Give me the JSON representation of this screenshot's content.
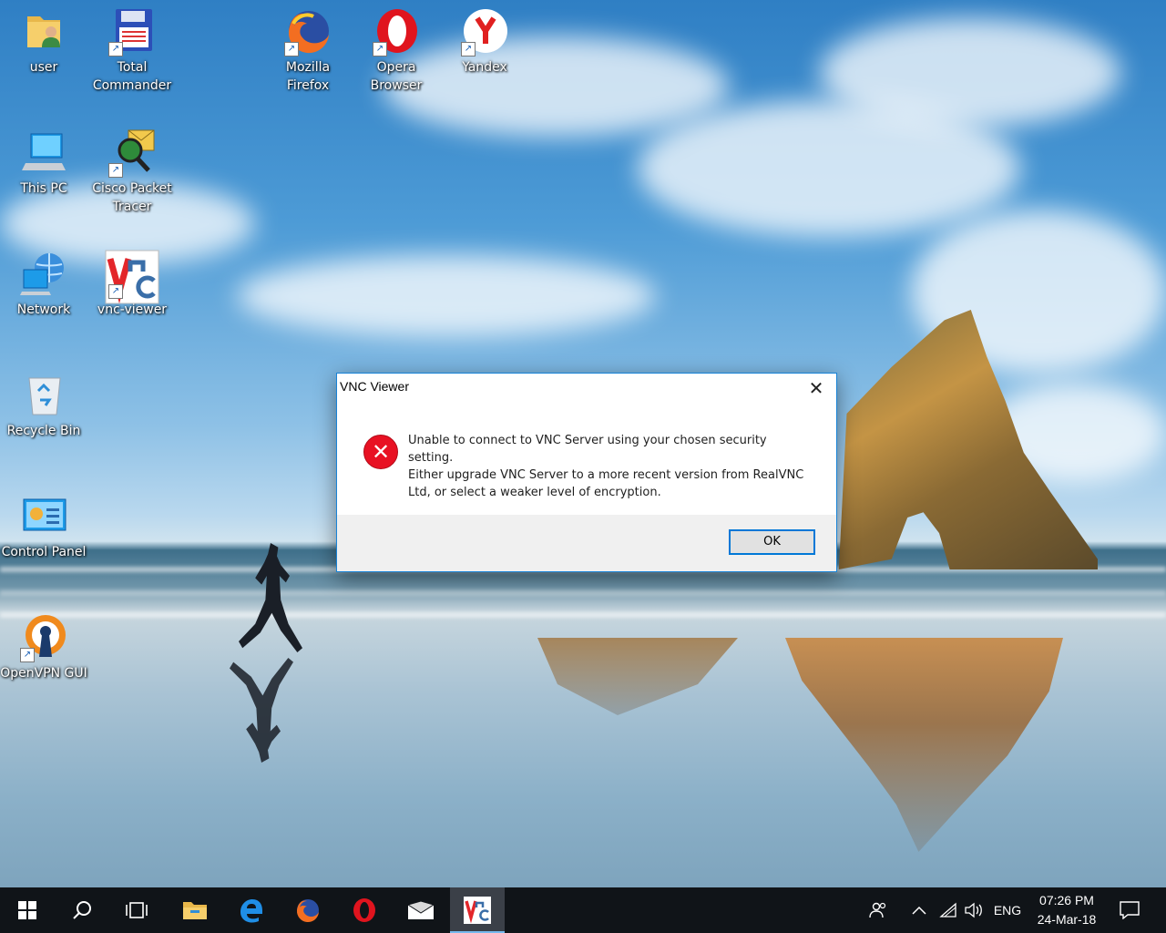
{
  "desktop": {
    "icons": [
      {
        "label": "user",
        "icon": "user-folder-icon"
      },
      {
        "label": "Total Commander",
        "icon": "total-commander-icon"
      },
      {
        "label": "Mozilla Firefox",
        "icon": "firefox-icon"
      },
      {
        "label": "Opera Browser",
        "icon": "opera-icon"
      },
      {
        "label": "Yandex",
        "icon": "yandex-icon"
      },
      {
        "label": "This PC",
        "icon": "this-pc-icon"
      },
      {
        "label": "Cisco Packet Tracer",
        "icon": "cisco-packet-tracer-icon"
      },
      {
        "label": "Network",
        "icon": "network-icon"
      },
      {
        "label": "vnc-viewer",
        "icon": "vnc-viewer-icon"
      },
      {
        "label": "Recycle Bin",
        "icon": "recycle-bin-icon"
      },
      {
        "label": "Control Panel",
        "icon": "control-panel-icon"
      },
      {
        "label": "OpenVPN GUI",
        "icon": "openvpn-icon"
      }
    ]
  },
  "dialog": {
    "title": "VNC Viewer",
    "close_glyph": "✕",
    "message_lines": [
      "Unable to connect to VNC Server using your chosen security setting.",
      "Either upgrade VNC Server to a more recent version from RealVNC",
      "Ltd, or select a weaker level of encryption."
    ],
    "ok_label": "OK"
  },
  "taskbar": {
    "pinned": [
      "start-icon",
      "search-icon",
      "task-view-icon",
      "file-explorer-icon",
      "edge-icon",
      "firefox-icon",
      "opera-icon",
      "mail-icon",
      "vnc-viewer-icon"
    ],
    "language": "ENG",
    "clock": {
      "time": "07:26 PM",
      "date": "24-Mar-18"
    }
  },
  "colors": {
    "accent": "#0078d7",
    "error": "#e81123",
    "taskbar": "#101418"
  }
}
